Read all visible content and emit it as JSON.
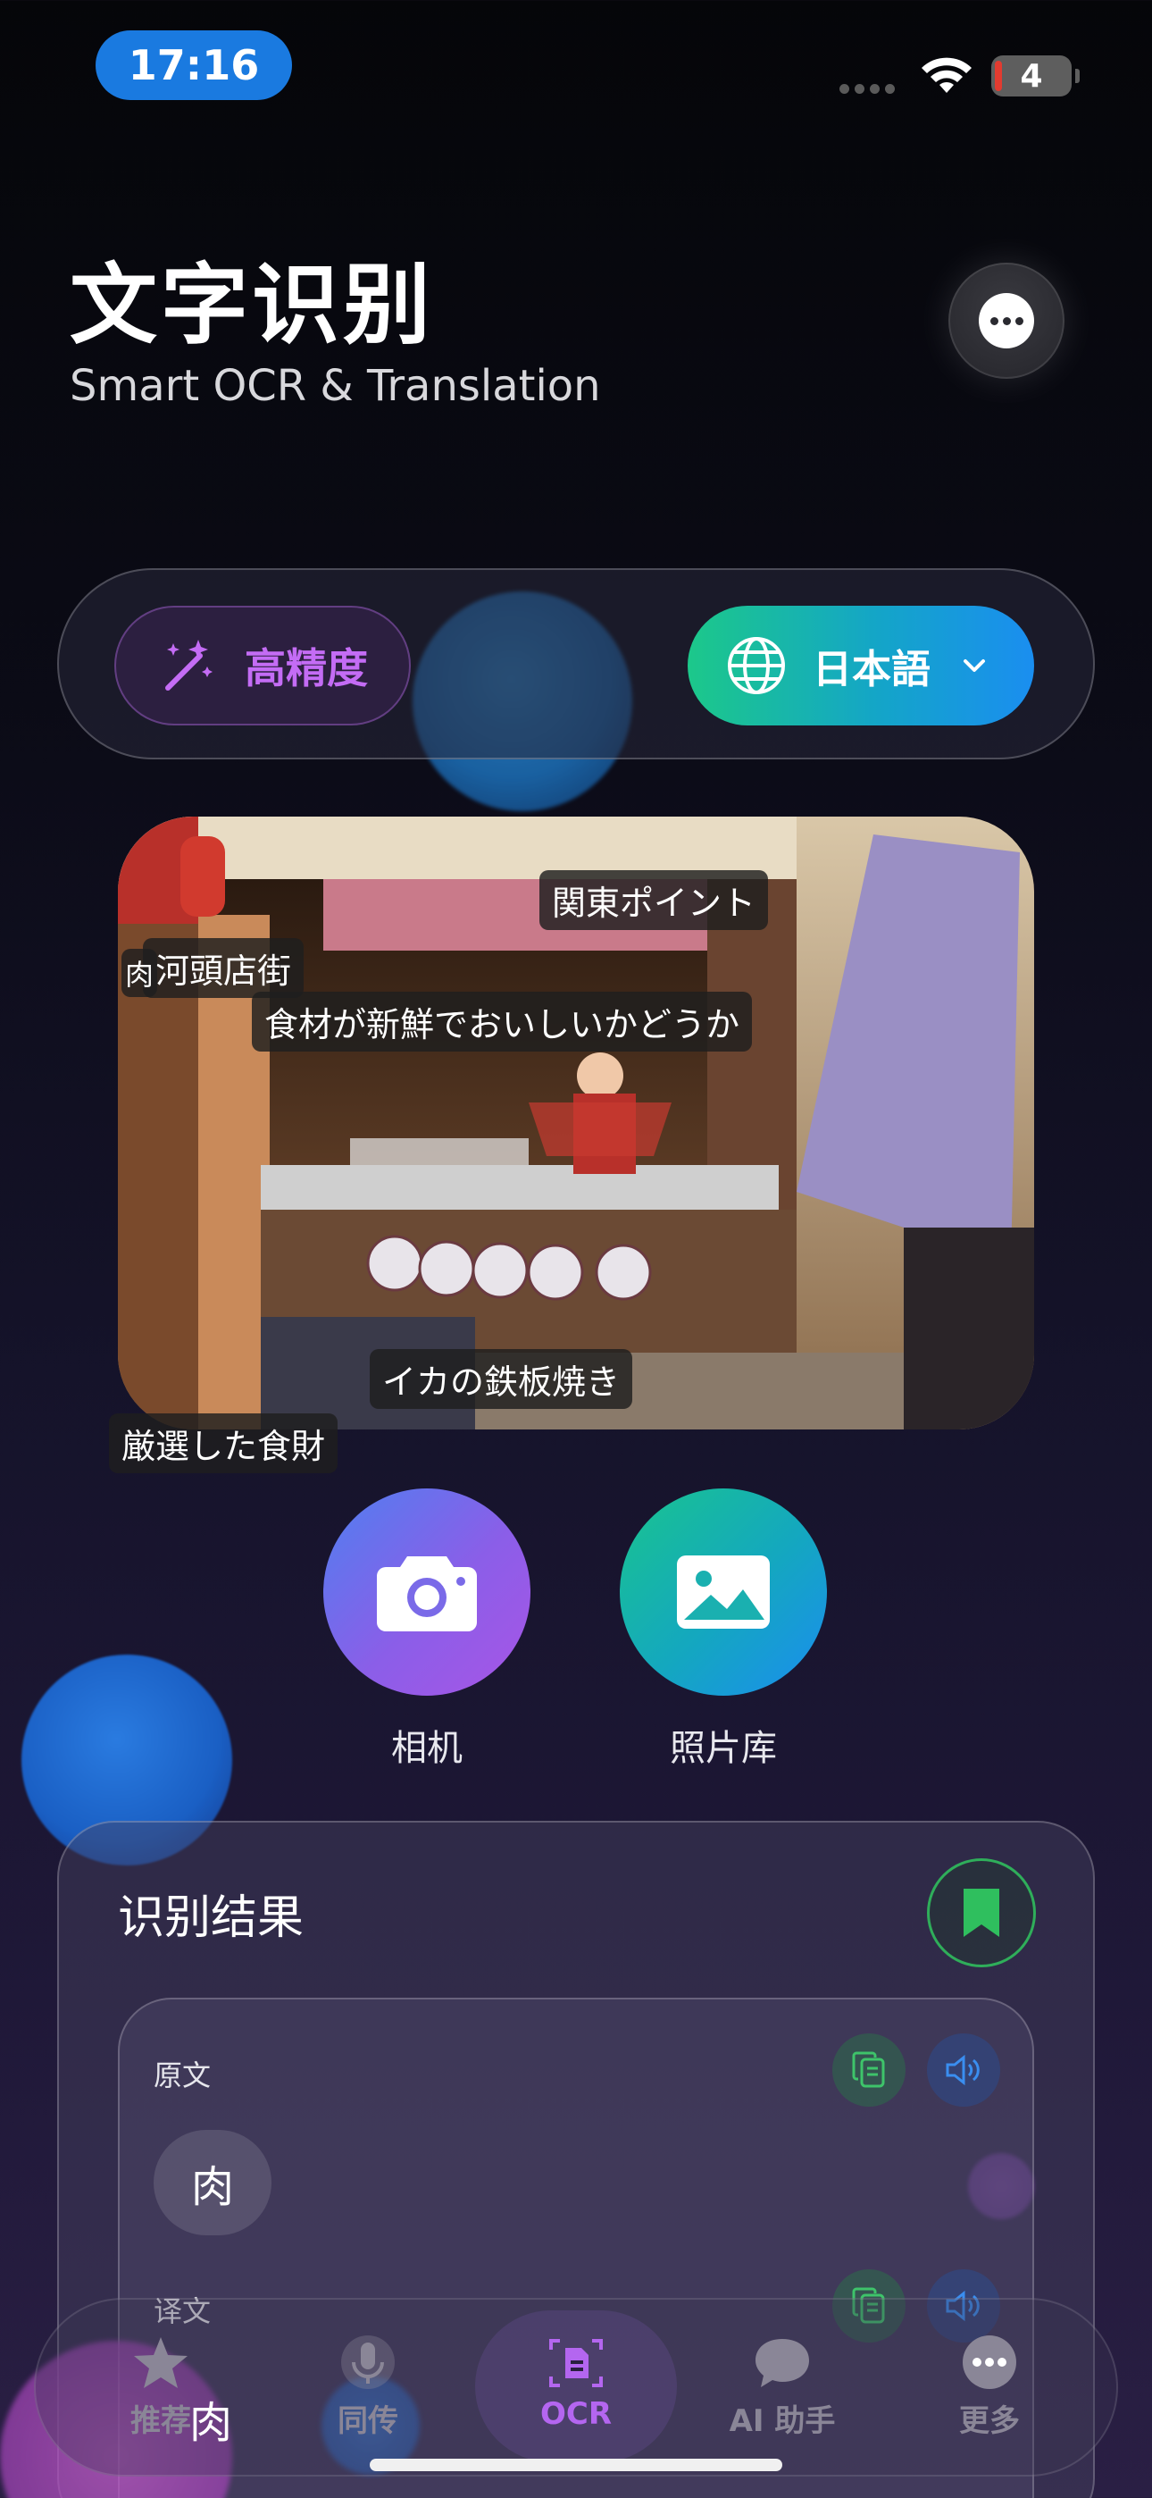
{
  "status_bar": {
    "time": "17:16",
    "battery": "4"
  },
  "header": {
    "title": "文字识别",
    "subtitle": "Smart OCR & Translation"
  },
  "controls": {
    "precision_label": "高精度",
    "language_label": "日本語"
  },
  "photo": {
    "ocr_tags": [
      "関東ポイント",
      "河頭店街",
      "肉",
      "食材が新鮮でおいしいかどうか",
      "イカの鉄板焼き",
      "厳選した食財"
    ]
  },
  "actions": {
    "camera_label": "相机",
    "library_label": "照片库"
  },
  "results": {
    "title": "识别结果",
    "source_label": "原文",
    "source_text": "肉",
    "translation_label": "译文",
    "translation_text": "肉"
  },
  "tabs": [
    {
      "label": "推荐",
      "icon": "star-icon"
    },
    {
      "label": "同传",
      "icon": "microphone-icon"
    },
    {
      "label": "OCR",
      "icon": "scan-document-icon",
      "active": true
    },
    {
      "label": "AI 助手",
      "icon": "chat-bubble-icon"
    },
    {
      "label": "更多",
      "icon": "more-dots-icon"
    }
  ],
  "colors": {
    "accent_purple": "#b466f0",
    "brand_green": "#1cc88a",
    "brand_blue": "#1a8ef0"
  }
}
